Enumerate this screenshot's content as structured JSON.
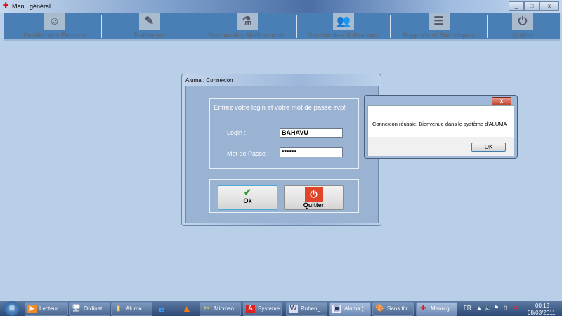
{
  "window": {
    "title": "Menu général"
  },
  "toolbar": {
    "items": [
      {
        "label": "Gestion des Patients",
        "icon": "patient-icon"
      },
      {
        "label": "Traitement",
        "icon": "syringe-icon"
      },
      {
        "label": "Gestion des Médicaments",
        "icon": "medicine-icon"
      },
      {
        "label": "Gestion des Utilisateurs",
        "icon": "users-icon"
      },
      {
        "label": "Rapports et Statistiques",
        "icon": "report-icon"
      },
      {
        "label": "Quitter",
        "icon": "power-icon"
      }
    ]
  },
  "login": {
    "title": "Aluma : Connexion",
    "prompt": "Entrez votre login et votre mot de passe svp!",
    "login_label": "Login :",
    "login_value": "BAHAVU",
    "password_label": "Mot de Passe :",
    "password_value": "******",
    "ok_label": "Ok",
    "quit_label": "Quitter"
  },
  "message": {
    "text": "Connexion réussie. Bienvenue dans le système d'ALUMA",
    "ok_label": "OK",
    "close": "x"
  },
  "taskbar": {
    "items": [
      {
        "label": "Lecteur ..."
      },
      {
        "label": "Ordinat..."
      },
      {
        "label": "Aluma"
      },
      {
        "label": ""
      },
      {
        "label": ""
      },
      {
        "label": "Microso..."
      },
      {
        "label": "Système..."
      },
      {
        "label": "Ruben_..."
      },
      {
        "label": "Aluma (..."
      },
      {
        "label": "Sans titr..."
      },
      {
        "label": "Menu g..."
      }
    ],
    "lang": "FR",
    "time": "00:13",
    "date": "08/03/2011"
  }
}
